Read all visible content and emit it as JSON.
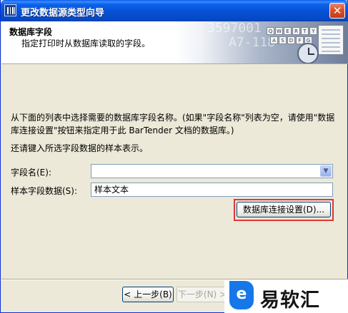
{
  "window": {
    "title": "更改数据源类型向导",
    "close_glyph": "✕"
  },
  "header": {
    "heading": "数据库字段",
    "subheading": "指定打印时从数据库读取的字段。",
    "decor_numbers": [
      "3597001",
      "A7-118"
    ],
    "decor_keys": [
      "Q",
      "W",
      "E",
      "R",
      "T",
      "Y",
      "A",
      "S",
      "D",
      "F",
      "G"
    ]
  },
  "content": {
    "description": "从下面的列表中选择需要的数据库字段名称。(如果\"字段名称\"列表为空，请使用\"数据库连接设置\"按钮来指定用于此 BarTender 文档的数据库。)",
    "instruction": "还请键入所选字段数据的样本表示。"
  },
  "form": {
    "field_name_label": "字段名(E):",
    "field_name_value": "",
    "sample_label": "样本字段数据(S):",
    "sample_value": "样本文本",
    "db_settings_button": "数据库连接设置(D)..."
  },
  "footer": {
    "back_button": "< 上一步(B)",
    "next_button": "下一步(N) >"
  },
  "watermark": {
    "logo_glyph": "e",
    "text": "易软汇"
  },
  "colors": {
    "titlebar": "#0651d4",
    "highlight": "#e03838",
    "dialog_bg": "#ece9d8",
    "watermark_blue": "#1677e8"
  }
}
